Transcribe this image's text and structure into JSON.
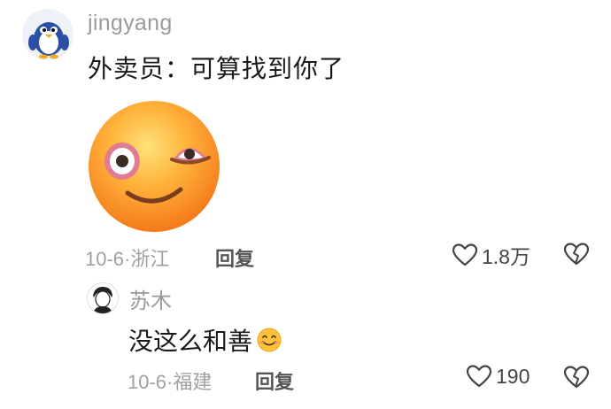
{
  "main_comment": {
    "username": "jingyang",
    "text": "外卖员：可算找到你了",
    "date": "10-6",
    "location": "浙江",
    "reply_label": "回复",
    "likes": "1.8万",
    "icons": {
      "avatar": "penguin-avatar",
      "sticker": "flushed-emoji-sticker",
      "like": "heart-icon",
      "dislike": "broken-heart-icon"
    }
  },
  "reply_comment": {
    "username": "苏木",
    "text": "没这么和善",
    "date": "10-6",
    "location": "福建",
    "reply_label": "回复",
    "likes": "190",
    "icons": {
      "avatar": "sketch-avatar",
      "inline_emoji": "smile-emoji",
      "like": "heart-icon",
      "dislike": "broken-heart-icon"
    }
  },
  "colors": {
    "meta_gray": "#a0a0a0",
    "text": "#1a1a1a",
    "emoji_orange": "#f7931e"
  }
}
